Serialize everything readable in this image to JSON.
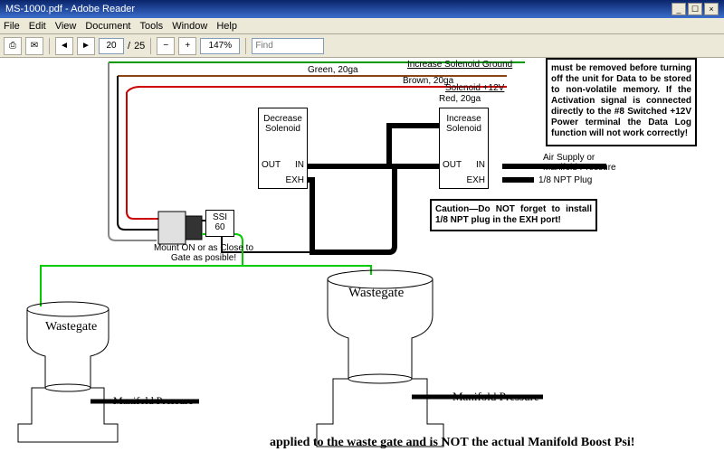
{
  "window": {
    "title": "MS-1000.pdf - Adobe Reader",
    "min": "_",
    "max": "☐",
    "close": "×"
  },
  "menu": {
    "file": "File",
    "edit": "Edit",
    "view": "View",
    "document": "Document",
    "tools": "Tools",
    "window": "Window",
    "help": "Help"
  },
  "toolbar": {
    "page": "20",
    "pages": "25",
    "zoom": "147%",
    "find": "Find"
  },
  "wires": {
    "green_label": "Green, 20ga",
    "brown_label": "Brown, 20ga",
    "red_label": "Red, 20ga",
    "inc_gnd": "Increase Solenoid Ground",
    "sol12v": "Solenoid +12V"
  },
  "solenoid": {
    "dec": "Decrease Solenoid",
    "inc": "Increase Solenoid",
    "in": "IN",
    "out": "OUT",
    "exh": "EXH"
  },
  "ssi": {
    "label": "SSI 60",
    "mount": "Mount ON or as Close to Gate as posible!"
  },
  "wastegate": {
    "label": "Wastegate",
    "manifold": "Manifold Pressure"
  },
  "air": {
    "supply": "Air Supply or Manifold Pressure",
    "plug": "1/8 NPT Plug"
  },
  "caution": "Caution—Do NOT forget to install 1/8 NPT plug in the EXH port!",
  "note": "must be removed before turning off the unit for Data to be stored to non-volatile memory. If the Activation signal is connected directly to the #8 Switched +12V Power terminal the Data Log function will not work correctly!",
  "bottom": "applied to the waste gate and is NOT the actual Manifold Boost Psi!"
}
